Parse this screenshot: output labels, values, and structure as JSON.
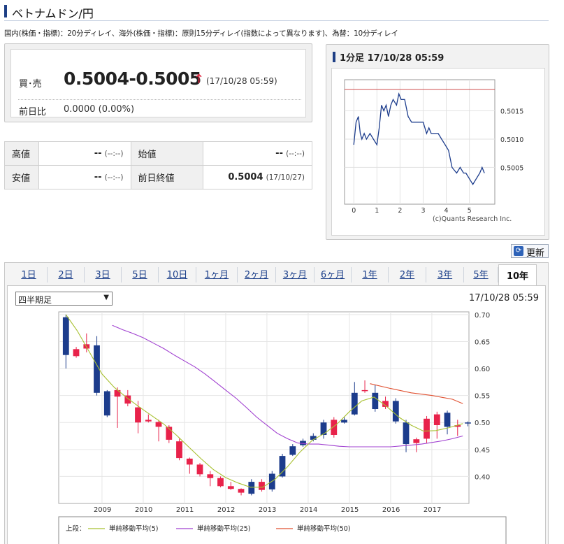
{
  "page": {
    "title": "ベトナムドン/円",
    "notice": "国内(株価・指標)：20分ディレイ、海外(株価・指標)：原則15分ディレイ(指数によって異なります)、為替：10分ディレイ"
  },
  "quote": {
    "bid_label": "買･売",
    "bid_value": "0.5004-0.5005",
    "arrow": "↑",
    "timestamp": "(17/10/28 05:59)",
    "change_label": "前日比",
    "change_value": "0.0000 (0.00%)"
  },
  "stats": {
    "high_label": "高値",
    "high_value": "--",
    "high_time": "(--:--)",
    "open_label": "始値",
    "open_value": "--",
    "open_time": "(--:--)",
    "low_label": "安値",
    "low_value": "--",
    "low_time": "(--:--)",
    "prev_label": "前日終値",
    "prev_value": "0.5004",
    "prev_time": "(17/10/27)"
  },
  "mini": {
    "header": "1分足 17/10/28 05:59",
    "credit": "(c)Quants Research Inc."
  },
  "refresh_label": "更新",
  "tabs": [
    "1日",
    "2日",
    "3日",
    "5日",
    "10日",
    "1ヶ月",
    "2ヶ月",
    "3ヶ月",
    "6ヶ月",
    "1年",
    "2年",
    "3年",
    "5年",
    "10年"
  ],
  "active_tab": "10年",
  "period_select": {
    "value": "四半期足"
  },
  "chart_time": "17/10/28 05:59",
  "legend": {
    "prefix": "上段：",
    "items": [
      "単純移動平均(5)",
      "単純移動平均(25)",
      "単純移動平均(50)"
    ]
  },
  "colors": {
    "up": "#e8224a",
    "down": "#1c3c8c",
    "sma5": "#a8c030",
    "sma25": "#a040d0",
    "sma50": "#e05030",
    "accent": "#1e3f85"
  },
  "chart_data": [
    {
      "type": "line",
      "title": "1分足 17/10/28 05:59",
      "x_ticks": [
        "0",
        "1",
        "2",
        "3",
        "4",
        "5"
      ],
      "y_ticks": [
        "0.5005",
        "0.5010",
        "0.5015"
      ],
      "xlim": [
        -0.4,
        6.1
      ],
      "ylim": [
        0.49985,
        0.50205
      ],
      "reference_line": 0.50188,
      "series": [
        {
          "x": [
            0,
            0.1,
            0.2,
            0.28,
            0.35,
            0.45,
            0.55,
            0.7,
            0.85,
            1.0,
            1.1,
            1.2,
            1.3,
            1.4,
            1.5,
            1.6,
            1.7,
            1.85,
            1.95,
            2.05,
            2.2,
            2.35,
            2.5,
            2.6,
            2.8,
            3.0,
            3.15,
            3.25,
            3.35,
            3.5,
            3.65,
            3.8,
            3.95,
            4.1,
            4.25,
            4.45,
            4.6,
            4.75,
            4.85,
            5.0,
            5.15,
            5.3,
            5.45,
            5.55,
            5.65
          ],
          "y": [
            0.5009,
            0.5013,
            0.5014,
            0.5011,
            0.501,
            0.5011,
            0.501,
            0.5011,
            0.501,
            0.5009,
            0.5012,
            0.5016,
            0.5015,
            0.5016,
            0.5014,
            0.5016,
            0.5017,
            0.5016,
            0.5018,
            0.5017,
            0.5017,
            0.5014,
            0.5013,
            0.5013,
            0.5013,
            0.5013,
            0.5011,
            0.5012,
            0.5011,
            0.5011,
            0.5011,
            0.501,
            0.5009,
            0.5008,
            0.5005,
            0.5004,
            0.5005,
            0.5004,
            0.5004,
            0.5003,
            0.5002,
            0.5003,
            0.5004,
            0.5005,
            0.5004
          ]
        }
      ]
    },
    {
      "type": "candlestick",
      "period": "四半期足",
      "x_ticks": [
        "2009",
        "2010",
        "2011",
        "2012",
        "2013",
        "2014",
        "2015",
        "2016",
        "2017"
      ],
      "y_ticks": [
        "0.40",
        "0.45",
        "0.50",
        "0.55",
        "0.60",
        "0.65",
        "0.70"
      ],
      "xlim": [
        2007.95,
        2017.9
      ],
      "ylim": [
        0.35,
        0.705
      ],
      "grid": true,
      "candles_x": [
        2008.125,
        2008.375,
        2008.625,
        2008.875,
        2009.125,
        2009.375,
        2009.625,
        2009.875,
        2010.125,
        2010.375,
        2010.625,
        2010.875,
        2011.125,
        2011.375,
        2011.625,
        2011.875,
        2012.125,
        2012.375,
        2012.625,
        2012.875,
        2013.125,
        2013.375,
        2013.625,
        2013.875,
        2014.125,
        2014.375,
        2014.625,
        2014.875,
        2015.125,
        2015.375,
        2015.625,
        2015.875,
        2016.125,
        2016.375,
        2016.625,
        2016.875,
        2017.125,
        2017.375,
        2017.625,
        2017.875
      ],
      "open": [
        0.695,
        0.623,
        0.637,
        0.643,
        0.558,
        0.548,
        0.535,
        0.5,
        0.502,
        0.492,
        0.468,
        0.434,
        0.422,
        0.404,
        0.397,
        0.382,
        0.377,
        0.37,
        0.39,
        0.375,
        0.405,
        0.438,
        0.456,
        0.466,
        0.475,
        0.5,
        0.477,
        0.505,
        0.555,
        0.558,
        0.555,
        0.529,
        0.54,
        0.5,
        0.462,
        0.47,
        0.495,
        0.518,
        0.492,
        0.5
      ],
      "close": [
        0.625,
        0.636,
        0.645,
        0.555,
        0.513,
        0.56,
        0.55,
        0.528,
        0.505,
        0.501,
        0.492,
        0.465,
        0.433,
        0.422,
        0.404,
        0.397,
        0.382,
        0.377,
        0.368,
        0.39,
        0.376,
        0.4,
        0.44,
        0.458,
        0.468,
        0.477,
        0.505,
        0.5,
        0.515,
        0.56,
        0.525,
        0.54,
        0.502,
        0.46,
        0.469,
        0.507,
        0.515,
        0.492,
        0.495,
        0.498
      ],
      "high": [
        0.7,
        0.64,
        0.665,
        0.66,
        0.56,
        0.565,
        0.56,
        0.54,
        0.515,
        0.505,
        0.495,
        0.47,
        0.435,
        0.425,
        0.41,
        0.4,
        0.39,
        0.378,
        0.395,
        0.395,
        0.41,
        0.442,
        0.46,
        0.47,
        0.48,
        0.505,
        0.51,
        0.51,
        0.575,
        0.578,
        0.57,
        0.548,
        0.545,
        0.505,
        0.472,
        0.512,
        0.52,
        0.522,
        0.505,
        0.502
      ],
      "low": [
        0.6,
        0.62,
        0.63,
        0.55,
        0.51,
        0.49,
        0.53,
        0.48,
        0.5,
        0.465,
        0.462,
        0.43,
        0.405,
        0.4,
        0.382,
        0.38,
        0.375,
        0.365,
        0.365,
        0.372,
        0.372,
        0.398,
        0.438,
        0.455,
        0.465,
        0.47,
        0.472,
        0.498,
        0.513,
        0.555,
        0.52,
        0.525,
        0.498,
        0.445,
        0.445,
        0.462,
        0.47,
        0.478,
        0.475,
        0.493
      ],
      "sma5": {
        "x": [
          2008.125,
          2008.4,
          2008.7,
          2009.0,
          2009.3,
          2009.6,
          2009.9,
          2010.2,
          2010.5,
          2010.8,
          2011.1,
          2011.4,
          2011.7,
          2012.0,
          2012.3,
          2012.6,
          2012.9,
          2013.2,
          2013.5,
          2013.8,
          2014.1,
          2014.4,
          2014.7,
          2015.0,
          2015.3,
          2015.6,
          2015.9,
          2016.2,
          2016.5,
          2016.8,
          2017.1,
          2017.4,
          2017.75
        ],
        "y": [
          0.7,
          0.67,
          0.63,
          0.59,
          0.565,
          0.546,
          0.529,
          0.513,
          0.497,
          0.477,
          0.455,
          0.433,
          0.413,
          0.398,
          0.388,
          0.38,
          0.38,
          0.395,
          0.418,
          0.445,
          0.467,
          0.48,
          0.497,
          0.52,
          0.54,
          0.547,
          0.53,
          0.51,
          0.495,
          0.484,
          0.485,
          0.49,
          0.498
        ]
      },
      "sma25": {
        "x": [
          2009.25,
          2009.5,
          2009.75,
          2010.0,
          2010.25,
          2010.5,
          2010.75,
          2011.0,
          2011.25,
          2011.5,
          2011.75,
          2012.0,
          2012.25,
          2012.5,
          2012.75,
          2013.0,
          2013.25,
          2013.5,
          2013.75,
          2014.0,
          2014.25,
          2014.5,
          2014.75,
          2015.0,
          2015.5,
          2016.0,
          2016.5,
          2016.75,
          2017.0,
          2017.25,
          2017.5,
          2017.75
        ],
        "y": [
          0.68,
          0.672,
          0.665,
          0.657,
          0.647,
          0.637,
          0.625,
          0.614,
          0.603,
          0.59,
          0.575,
          0.56,
          0.545,
          0.528,
          0.51,
          0.495,
          0.48,
          0.47,
          0.462,
          0.46,
          0.46,
          0.458,
          0.456,
          0.455,
          0.455,
          0.455,
          0.458,
          0.46,
          0.463,
          0.466,
          0.47,
          0.475
        ]
      },
      "sma50": {
        "x": [
          2015.5,
          2016.0,
          2016.5,
          2017.0,
          2017.5,
          2017.75
        ],
        "y": [
          0.572,
          0.563,
          0.555,
          0.55,
          0.543,
          0.535
        ]
      }
    }
  ]
}
